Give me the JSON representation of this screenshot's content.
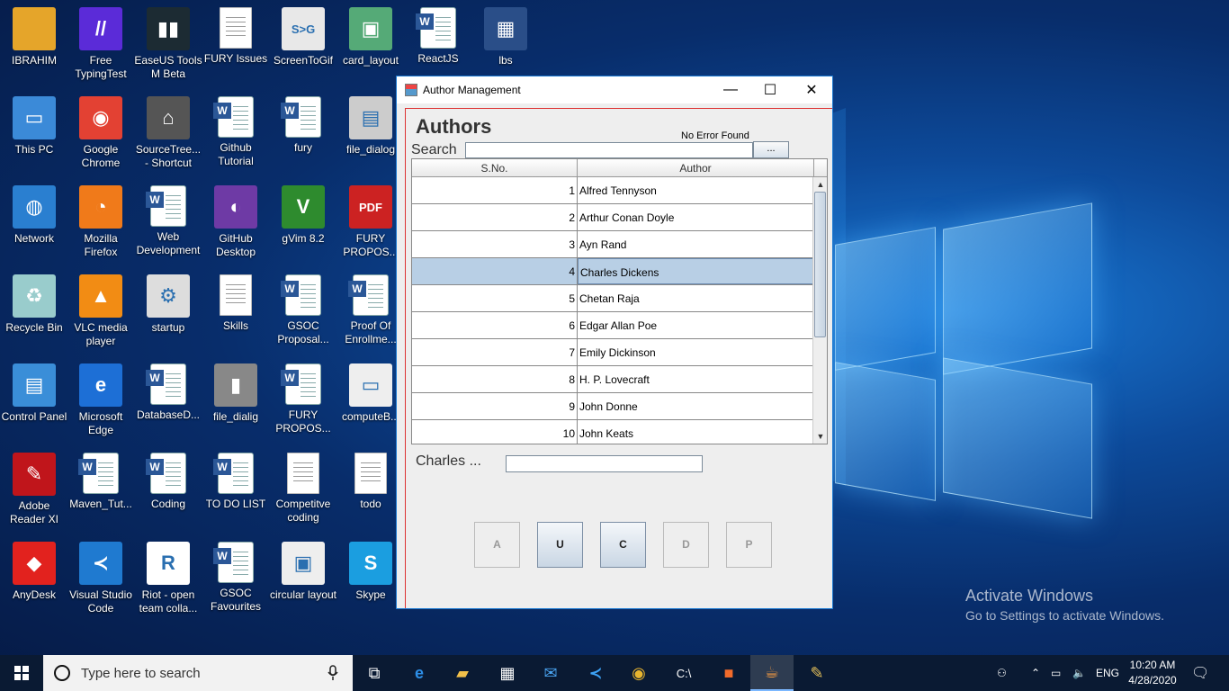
{
  "desktop": {
    "icons": [
      {
        "label": "IBRAHIM"
      },
      {
        "label": "Free TypingTest"
      },
      {
        "label": "EaseUS Tools M Beta"
      },
      {
        "label": "FURY Issues"
      },
      {
        "label": "ScreenToGif"
      },
      {
        "label": "card_layout"
      },
      {
        "label": "ReactJS"
      },
      {
        "label": "lbs"
      },
      {
        "label": "This PC"
      },
      {
        "label": "Google Chrome"
      },
      {
        "label": "SourceTree... - Shortcut"
      },
      {
        "label": "Github Tutorial"
      },
      {
        "label": "fury"
      },
      {
        "label": "file_dialog"
      },
      {
        "label": "Network"
      },
      {
        "label": "Mozilla Firefox"
      },
      {
        "label": "Web Development"
      },
      {
        "label": "GitHub Desktop"
      },
      {
        "label": "gVim 8.2"
      },
      {
        "label": "FURY PROPOS..."
      },
      {
        "label": "Recycle Bin"
      },
      {
        "label": "VLC media player"
      },
      {
        "label": "startup"
      },
      {
        "label": "Skills"
      },
      {
        "label": "GSOC Proposal..."
      },
      {
        "label": "Proof Of Enrollme..."
      },
      {
        "label": "Control Panel"
      },
      {
        "label": "Microsoft Edge"
      },
      {
        "label": "DatabaseD..."
      },
      {
        "label": "file_dialig"
      },
      {
        "label": "FURY PROPOS..."
      },
      {
        "label": "computeB..."
      },
      {
        "label": "Adobe Reader XI"
      },
      {
        "label": "Maven_Tut..."
      },
      {
        "label": "Coding"
      },
      {
        "label": "TO DO LIST"
      },
      {
        "label": "Competitve coding"
      },
      {
        "label": "todo"
      },
      {
        "label": "AnyDesk"
      },
      {
        "label": "Visual Studio Code"
      },
      {
        "label": "Riot - open team colla..."
      },
      {
        "label": "GSOC Favourites"
      },
      {
        "label": "circular layout"
      },
      {
        "label": "Skype"
      }
    ],
    "watermark": {
      "line1": "Activate Windows",
      "line2": "Go to Settings to activate Windows."
    }
  },
  "window": {
    "title": "Author Management",
    "minimize": "—",
    "maximize": "☐",
    "close": "✕",
    "heading": "Authors",
    "error_text": "No Error Found",
    "search_label": "Search",
    "search_value": "",
    "search_button": "...",
    "table": {
      "columns": [
        "S.No.",
        "Author"
      ],
      "rows": [
        {
          "no": "1",
          "author": "Alfred Tennyson"
        },
        {
          "no": "2",
          "author": "Arthur Conan Doyle"
        },
        {
          "no": "3",
          "author": "Ayn Rand"
        },
        {
          "no": "4",
          "author": "Charles Dickens",
          "selected": true
        },
        {
          "no": "5",
          "author": "Chetan Raja"
        },
        {
          "no": "6",
          "author": "Edgar Allan Poe"
        },
        {
          "no": "7",
          "author": "Emily Dickinson"
        },
        {
          "no": "8",
          "author": "H. P. Lovecraft"
        },
        {
          "no": "9",
          "author": "John Donne"
        },
        {
          "no": "10",
          "author": "John Keats"
        }
      ]
    },
    "selected_label": "Charles ...",
    "name_value": "",
    "buttons": [
      {
        "label": "A",
        "enabled": false
      },
      {
        "label": "U",
        "enabled": true
      },
      {
        "label": "C",
        "enabled": true
      },
      {
        "label": "D",
        "enabled": false
      },
      {
        "label": "P",
        "enabled": false
      }
    ]
  },
  "taskbar": {
    "search_placeholder": "Type here to search",
    "language": "ENG",
    "time": "10:20 AM",
    "date": "4/28/2020"
  },
  "colors": {
    "accent": "#1e7bd2",
    "selection": "#b8cfe5",
    "taskbar": "#0a1a33"
  }
}
